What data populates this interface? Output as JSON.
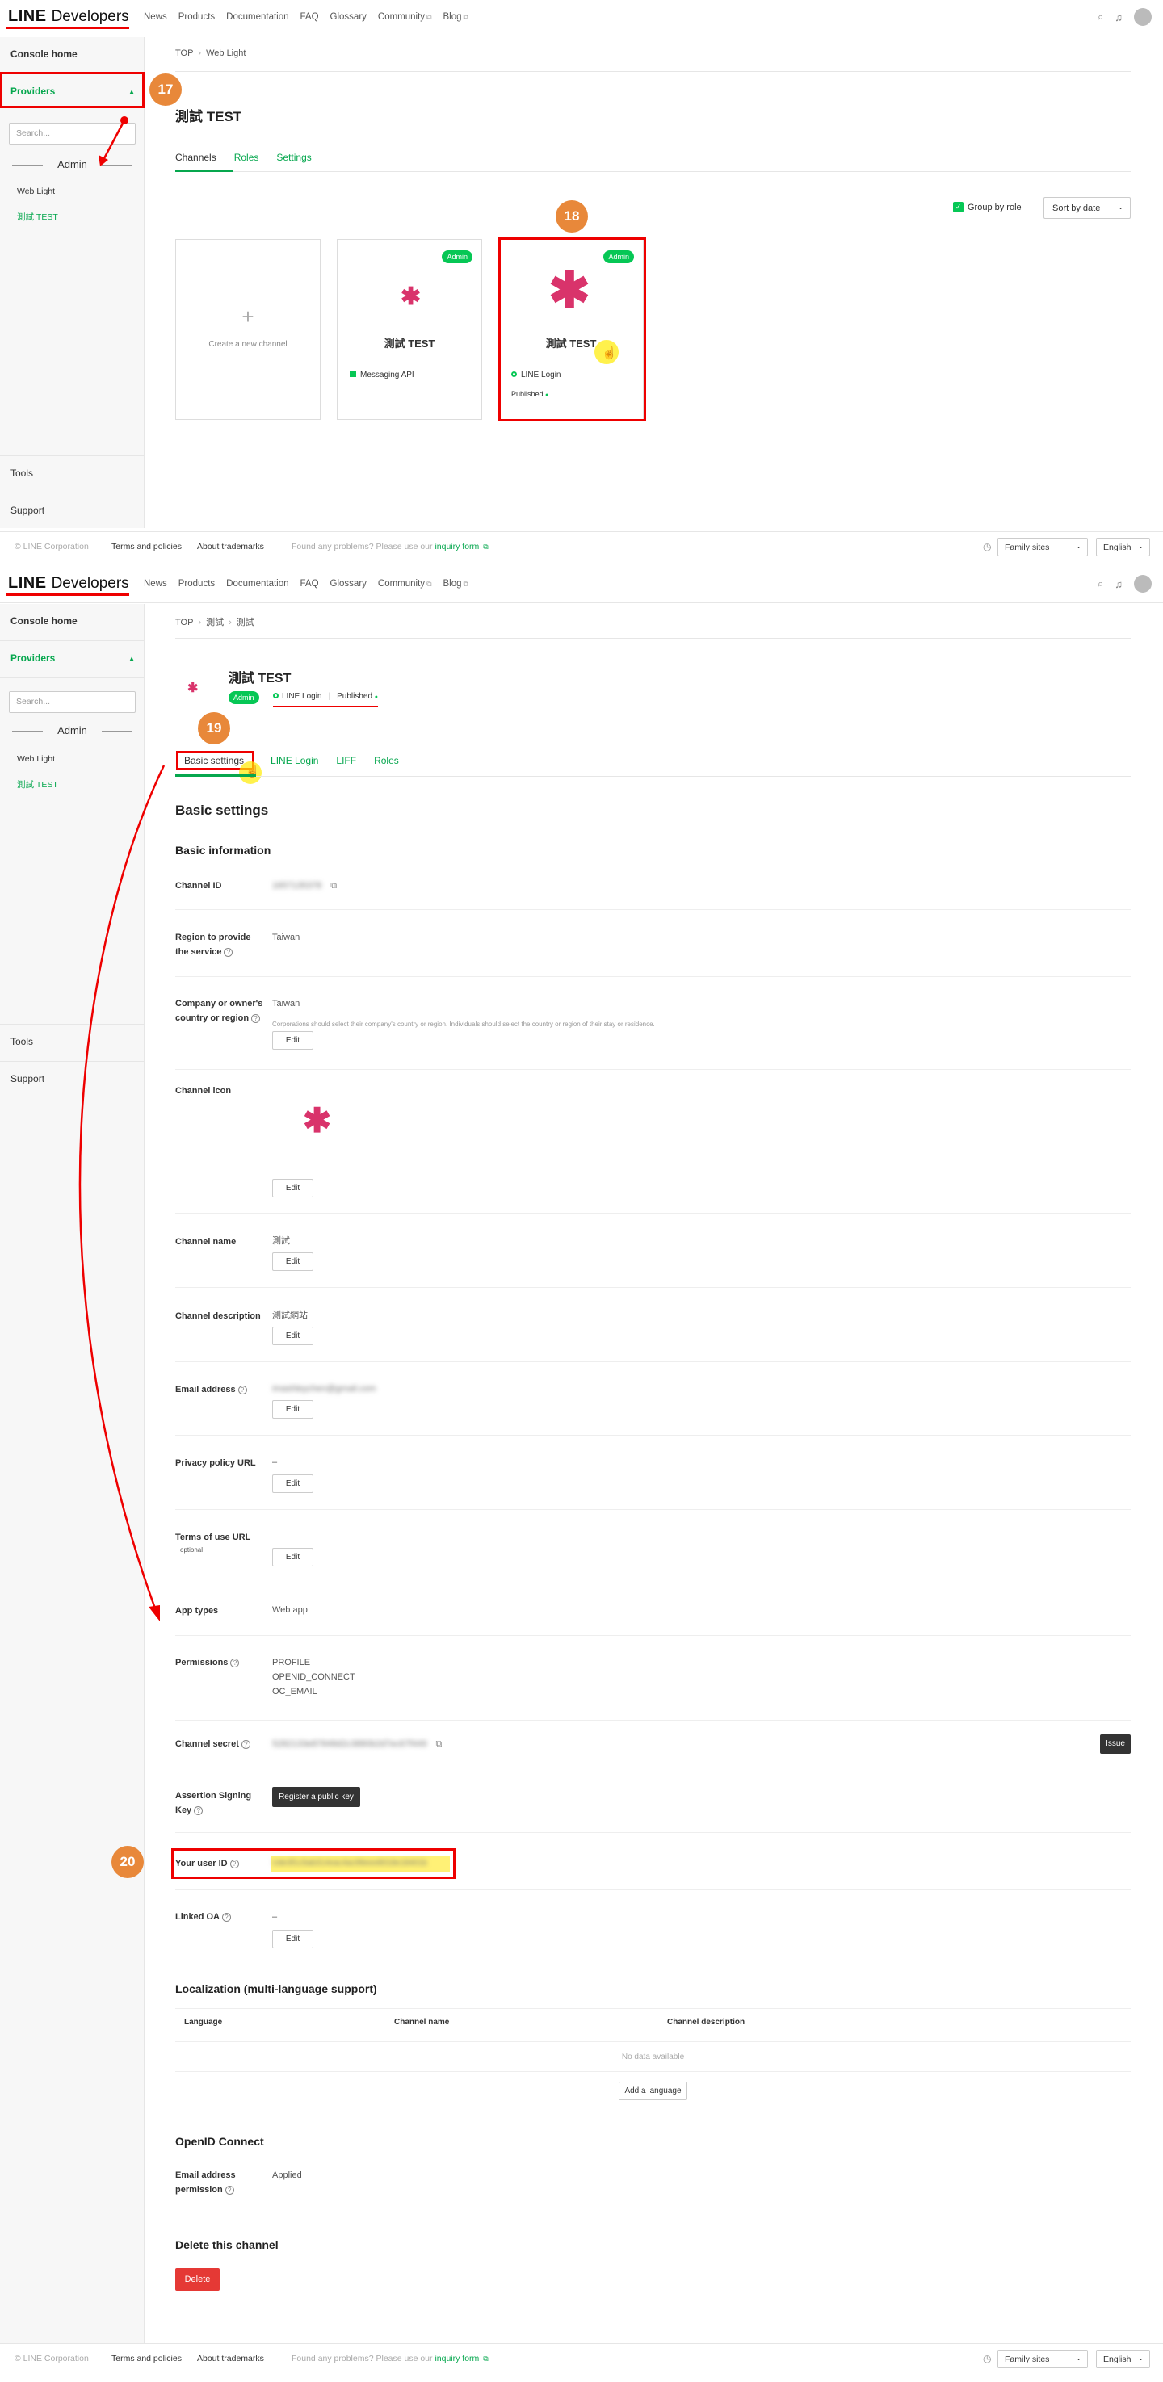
{
  "header": {
    "logo_line": "LINE",
    "logo_dev": "Developers",
    "nav": [
      "News",
      "Products",
      "Documentation",
      "FAQ",
      "Glossary",
      "Community",
      "Blog"
    ]
  },
  "sidebar": {
    "console_home": "Console home",
    "providers": "Providers",
    "search_placeholder": "Search...",
    "admin": "Admin",
    "items": [
      "Web Light",
      "測試 TEST"
    ],
    "tools": "Tools",
    "support": "Support"
  },
  "footer": {
    "copyright": "© LINE Corporation",
    "terms": "Terms and policies",
    "trademarks": "About trademarks",
    "help_prefix": "Found any problems? Please use our",
    "help_link": "inquiry form",
    "family_sites": "Family sites",
    "language": "English"
  },
  "provider_page": {
    "breadcrumb": [
      "TOP",
      "Web Light"
    ],
    "title": "測試 TEST",
    "tabs": [
      "Channels",
      "Roles",
      "Settings"
    ],
    "group_by_role": "Group by role",
    "sort": "Sort by date",
    "create_channel": "Create a new channel",
    "cards": [
      {
        "badge": "Admin",
        "name": "測試 TEST",
        "type": "Messaging API"
      },
      {
        "badge": "Admin",
        "name": "測試 TEST",
        "type": "LINE Login",
        "status": "Published"
      }
    ]
  },
  "channel_page": {
    "breadcrumb": [
      "TOP",
      "測試",
      "測試"
    ],
    "title": "測試 TEST",
    "badge": "Admin",
    "channel_type": "LINE Login",
    "status": "Published",
    "tabs": [
      "Basic settings",
      "LINE Login",
      "LIFF",
      "Roles"
    ],
    "heading": "Basic settings",
    "basic_info": "Basic information",
    "edit": "Edit",
    "rows": {
      "channel_id": {
        "label": "Channel ID",
        "value": "1657135378"
      },
      "region": {
        "label": "Region to provide the service",
        "value": "Taiwan"
      },
      "company": {
        "label": "Company or owner's country or region",
        "value": "Taiwan",
        "note": "Corporations should select their company's country or region. Individuals should select the country or region of their stay or residence."
      },
      "icon": {
        "label": "Channel icon"
      },
      "name": {
        "label": "Channel name",
        "value": "測試"
      },
      "description": {
        "label": "Channel description",
        "value": "測試網站"
      },
      "email": {
        "label": "Email address",
        "value": "imashleychen@gmail.com"
      },
      "privacy": {
        "label": "Privacy policy URL",
        "value": "–"
      },
      "terms": {
        "label": "Terms of use URL",
        "sub": "optional"
      },
      "app_types": {
        "label": "App types",
        "value": "Web app"
      },
      "permissions": {
        "label": "Permissions",
        "values": [
          "PROFILE",
          "OPENID_CONNECT",
          "OC_EMAIL"
        ]
      },
      "secret": {
        "label": "Channel secret",
        "value": "5282133e87848d2c3880b2d7ec67f449",
        "button": "Issue"
      },
      "assertion": {
        "label": "Assertion Signing Key",
        "button": "Register a public key"
      },
      "user_id": {
        "label": "Your user ID",
        "value": "Ude3f1c5ab314eac4ac99eee8018e18401b"
      },
      "linked_oa": {
        "label": "Linked OA",
        "value": "–"
      }
    },
    "localization": {
      "title": "Localization (multi-language support)",
      "columns": [
        "Language",
        "Channel name",
        "Channel description"
      ],
      "empty": "No data available",
      "add": "Add a language"
    },
    "openid": {
      "title": "OpenID Connect",
      "label": "Email address permission",
      "value": "Applied"
    },
    "delete": {
      "title": "Delete this channel",
      "button": "Delete"
    }
  },
  "steps": [
    "17",
    "18",
    "19",
    "20"
  ],
  "colors": {
    "green": "#06c755",
    "annotation_red": "#ee0000",
    "step_orange": "#e8883a",
    "icon_pink": "#d9336b"
  }
}
